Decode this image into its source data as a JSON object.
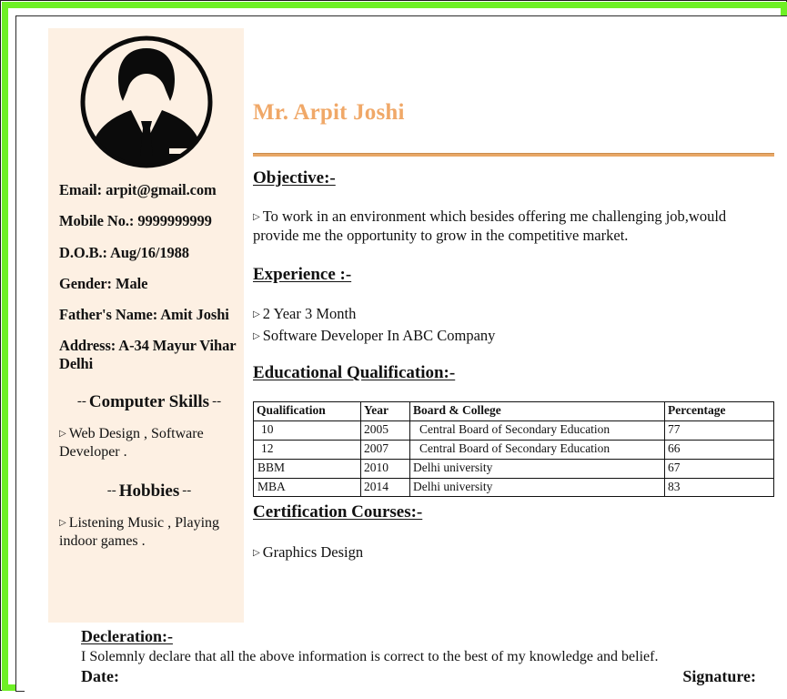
{
  "theme": {
    "border_green": "#6ef025",
    "sidebar_bg": "#fdf0e3",
    "name_color": "#f0a868",
    "divider_color": "#e8a766",
    "text_color": "#121212"
  },
  "sidebar": {
    "avatar_alt": "person-silhouette-avatar",
    "fields": [
      {
        "label": "Email: arpit@gmail.com"
      },
      {
        "label": "Mobile No.: 9999999999"
      },
      {
        "label": "D.O.B.: Aug/16/1988"
      },
      {
        "label": "Gender: Male"
      },
      {
        "label": "Father's Name: Amit Joshi"
      },
      {
        "label": "Address: A-34 Mayur Vihar Delhi"
      }
    ],
    "skills_heading": {
      "dash_left": "--",
      "text": "Computer Skills",
      "dash_right": "--"
    },
    "skills_items": [
      {
        "bullet": "▷",
        "text": "Web Design , Software Developer ."
      }
    ],
    "hobbies_heading": {
      "dash_left": "--",
      "text": "Hobbies",
      "dash_right": "--"
    },
    "hobbies_items": [
      {
        "bullet": "▷",
        "text": "Listening Music , Playing indoor games ."
      }
    ]
  },
  "main": {
    "name": "Mr. Arpit Joshi",
    "objective": {
      "heading": "Objective:-",
      "bullet": "▷",
      "text": "To work in an environment which besides offering me challenging job,would provide me the opportunity to grow in the competitive market."
    },
    "experience": {
      "heading": "Experience :-",
      "items": [
        {
          "bullet": "▷",
          "text": "2 Year 3 Month"
        },
        {
          "bullet": "▷",
          "text": "Software Developer In ABC Company"
        }
      ]
    },
    "education": {
      "heading": "Educational Qualification:-",
      "columns": [
        "Qualification",
        "Year",
        "Board & College",
        "Percentage"
      ],
      "rows": [
        {
          "qualification": "10",
          "year": "2005",
          "board": "Central Board of Secondary Education",
          "percentage": "77"
        },
        {
          "qualification": "12",
          "year": "2007",
          "board": "Central Board of Secondary Education",
          "percentage": "66"
        },
        {
          "qualification": "BBM",
          "year": "2010",
          "board": "Delhi university",
          "percentage": "67"
        },
        {
          "qualification": "MBA",
          "year": "2014",
          "board": "Delhi university",
          "percentage": "83"
        }
      ]
    },
    "certification": {
      "heading": "Certification Courses:-",
      "items": [
        {
          "bullet": "▷",
          "text": "Graphics Design"
        }
      ]
    }
  },
  "declaration": {
    "heading": "Decleration:-",
    "text": "I Solemnly declare that all the above information is correct to the best of my knowledge and belief.",
    "date_label": "Date:",
    "signature_label": "Signature:"
  }
}
